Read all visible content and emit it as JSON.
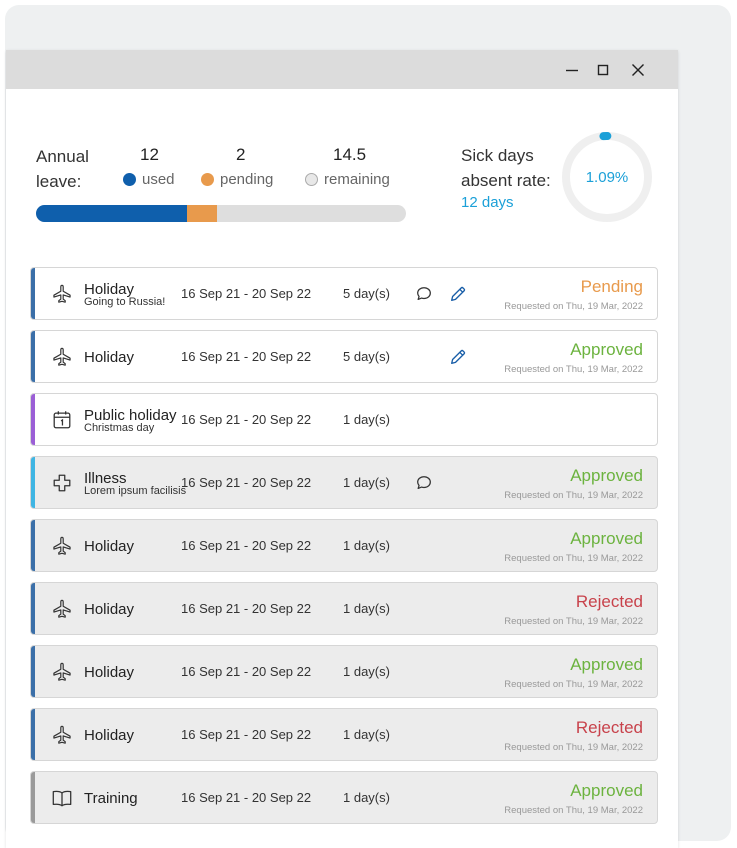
{
  "window": {
    "controls": [
      "minimize-icon",
      "maximize-icon",
      "close-icon"
    ]
  },
  "annual_leave": {
    "label": "Annual leave:",
    "used": {
      "value": "12",
      "label": "used"
    },
    "pending": {
      "value": "2",
      "label": "pending"
    },
    "remaining": {
      "value": "14.5",
      "label": "remaining"
    },
    "bar_fractions": {
      "used": 0.4068,
      "pending": 0.0812
    }
  },
  "sick": {
    "label": "Sick days absent rate:",
    "days": "12 days",
    "rate": "1.09%",
    "rate_fraction": 0.0109
  },
  "colors": {
    "used": "#0f5fac",
    "pending": "#e89a4c",
    "approved": "#6cb33f",
    "rejected": "#c8424b",
    "sick": "#1ba0d8",
    "accent_holiday": "#3b6fa8",
    "accent_public": "#9b5fd6",
    "accent_illness": "#3fb5e3",
    "accent_training": "#9a9a9a"
  },
  "requests": [
    {
      "type": "Holiday",
      "icon": "airplane-icon",
      "note": "Going to Russia!",
      "dates": "16 Sep 21 - 20 Sep 22",
      "days": "5 day(s)",
      "status": "Pending",
      "requested": "Requested on Thu, 19 Mar, 2022",
      "comment": true,
      "edit": true,
      "bg": "white",
      "accent": "holiday"
    },
    {
      "type": "Holiday",
      "icon": "airplane-icon",
      "note": "",
      "dates": "16 Sep 21 - 20 Sep 22",
      "days": "5 day(s)",
      "status": "Approved",
      "requested": "Requested on Thu, 19 Mar, 2022",
      "comment": false,
      "edit": true,
      "bg": "white",
      "accent": "holiday"
    },
    {
      "type": "Public holiday",
      "icon": "calendar-icon",
      "note": "Christmas day",
      "dates": "16 Sep 21 - 20 Sep 22",
      "days": "1 day(s)",
      "status": "",
      "requested": "",
      "comment": false,
      "edit": false,
      "bg": "white",
      "accent": "public"
    },
    {
      "type": "Illness",
      "icon": "medical-cross-icon",
      "note": "Lorem ipsum facilisis",
      "dates": "16 Sep 21 - 20 Sep 22",
      "days": "1 day(s)",
      "status": "Approved",
      "requested": "Requested on Thu, 19 Mar, 2022",
      "comment": true,
      "edit": false,
      "bg": "gray",
      "accent": "illness"
    },
    {
      "type": "Holiday",
      "icon": "airplane-icon",
      "note": "",
      "dates": "16 Sep 21 - 20 Sep 22",
      "days": "1 day(s)",
      "status": "Approved",
      "requested": "Requested on Thu, 19 Mar, 2022",
      "comment": false,
      "edit": false,
      "bg": "gray",
      "accent": "holiday"
    },
    {
      "type": "Holiday",
      "icon": "airplane-icon",
      "note": "",
      "dates": "16 Sep 21 - 20 Sep 22",
      "days": "1 day(s)",
      "status": "Rejected",
      "requested": "Requested on Thu, 19 Mar, 2022",
      "comment": false,
      "edit": false,
      "bg": "gray",
      "accent": "holiday"
    },
    {
      "type": "Holiday",
      "icon": "airplane-icon",
      "note": "",
      "dates": "16 Sep 21 - 20 Sep 22",
      "days": "1 day(s)",
      "status": "Approved",
      "requested": "Requested on Thu, 19 Mar, 2022",
      "comment": false,
      "edit": false,
      "bg": "gray",
      "accent": "holiday"
    },
    {
      "type": "Holiday",
      "icon": "airplane-icon",
      "note": "",
      "dates": "16 Sep 21 - 20 Sep 22",
      "days": "1 day(s)",
      "status": "Rejected",
      "requested": "Requested on Thu, 19 Mar, 2022",
      "comment": false,
      "edit": false,
      "bg": "gray",
      "accent": "holiday"
    },
    {
      "type": "Training",
      "icon": "book-icon",
      "note": "",
      "dates": "16 Sep 21 - 20 Sep 22",
      "days": "1 day(s)",
      "status": "Approved",
      "requested": "Requested on Thu, 19 Mar, 2022",
      "comment": false,
      "edit": false,
      "bg": "gray",
      "accent": "training"
    }
  ]
}
